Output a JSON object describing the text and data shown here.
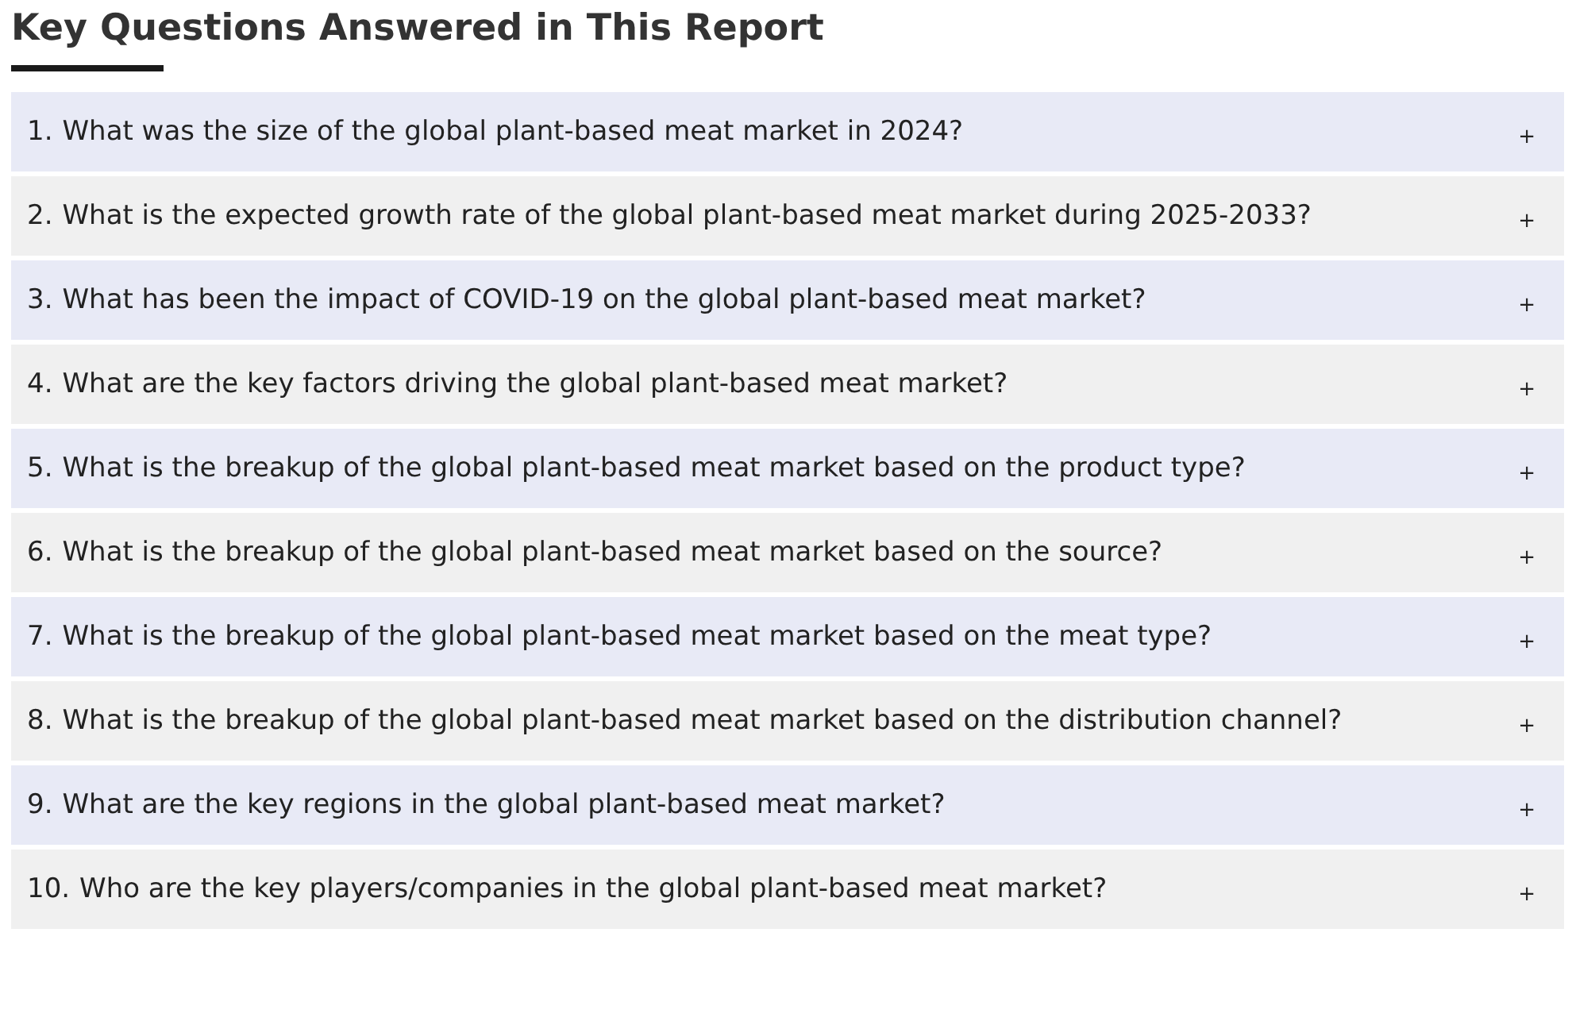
{
  "heading": "Key Questions Answered in This Report",
  "questions": [
    {
      "number": "1.",
      "text": "What was the size of the global plant-based meat market in 2024?",
      "toggle": "+"
    },
    {
      "number": "2.",
      "text": "What is the expected growth rate of the global plant-based meat market during 2025-2033?",
      "toggle": "+"
    },
    {
      "number": "3.",
      "text": "What has been the impact of COVID-19 on the global plant-based meat market?",
      "toggle": "+"
    },
    {
      "number": "4.",
      "text": "What are the key factors driving the global plant-based meat market?",
      "toggle": "+"
    },
    {
      "number": "5.",
      "text": "What is the breakup of the global plant-based meat market based on the product type?",
      "toggle": "+"
    },
    {
      "number": "6.",
      "text": "What is the breakup of the global plant-based meat market based on the source?",
      "toggle": "+"
    },
    {
      "number": "7.",
      "text": "What is the breakup of the global plant-based meat market based on the meat type?",
      "toggle": "+"
    },
    {
      "number": "8.",
      "text": "What is the breakup of the global plant-based meat market based on the distribution channel?",
      "toggle": "+"
    },
    {
      "number": "9.",
      "text": "What are the key regions in the global plant-based meat market?",
      "toggle": "+"
    },
    {
      "number": "10.",
      "text": "Who are the key players/companies in the global plant-based meat market?",
      "toggle": "+"
    }
  ]
}
